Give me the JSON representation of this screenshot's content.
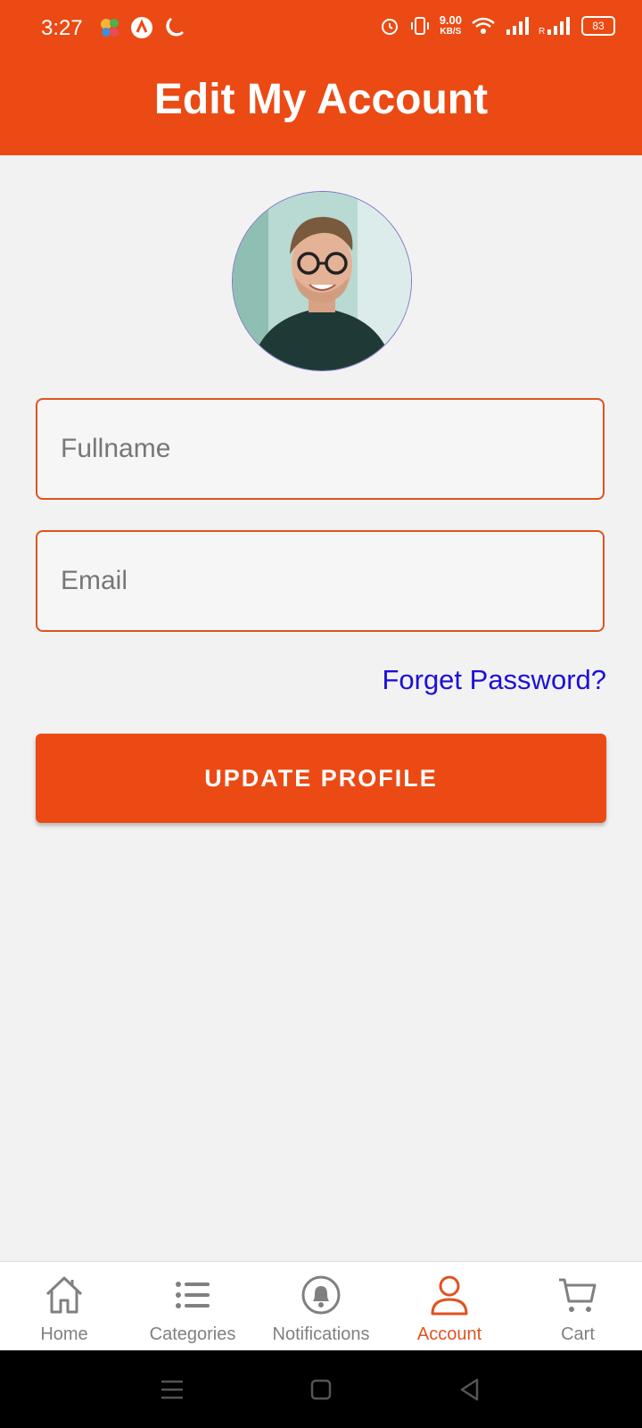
{
  "status_bar": {
    "time": "3:27",
    "net_speed_value": "9.00",
    "net_speed_unit": "KB/S",
    "battery": "83"
  },
  "header": {
    "title": "Edit My Account"
  },
  "form": {
    "fullname": {
      "placeholder": "Fullname",
      "value": ""
    },
    "email": {
      "placeholder": "Email",
      "value": ""
    },
    "forgot_password_label": "Forget Password?",
    "submit_label": "UPDATE PROFILE"
  },
  "bottom_nav": {
    "active": "Account",
    "accent_color": "#e0531f",
    "items": [
      {
        "label": "Home",
        "icon": "home-icon"
      },
      {
        "label": "Categories",
        "icon": "list-icon"
      },
      {
        "label": "Notifications",
        "icon": "bell-icon"
      },
      {
        "label": "Account",
        "icon": "user-icon"
      },
      {
        "label": "Cart",
        "icon": "cart-icon"
      }
    ]
  },
  "theme": {
    "primary": "#eb4a14",
    "link": "#1d10d8",
    "background": "#f2f2f2"
  }
}
